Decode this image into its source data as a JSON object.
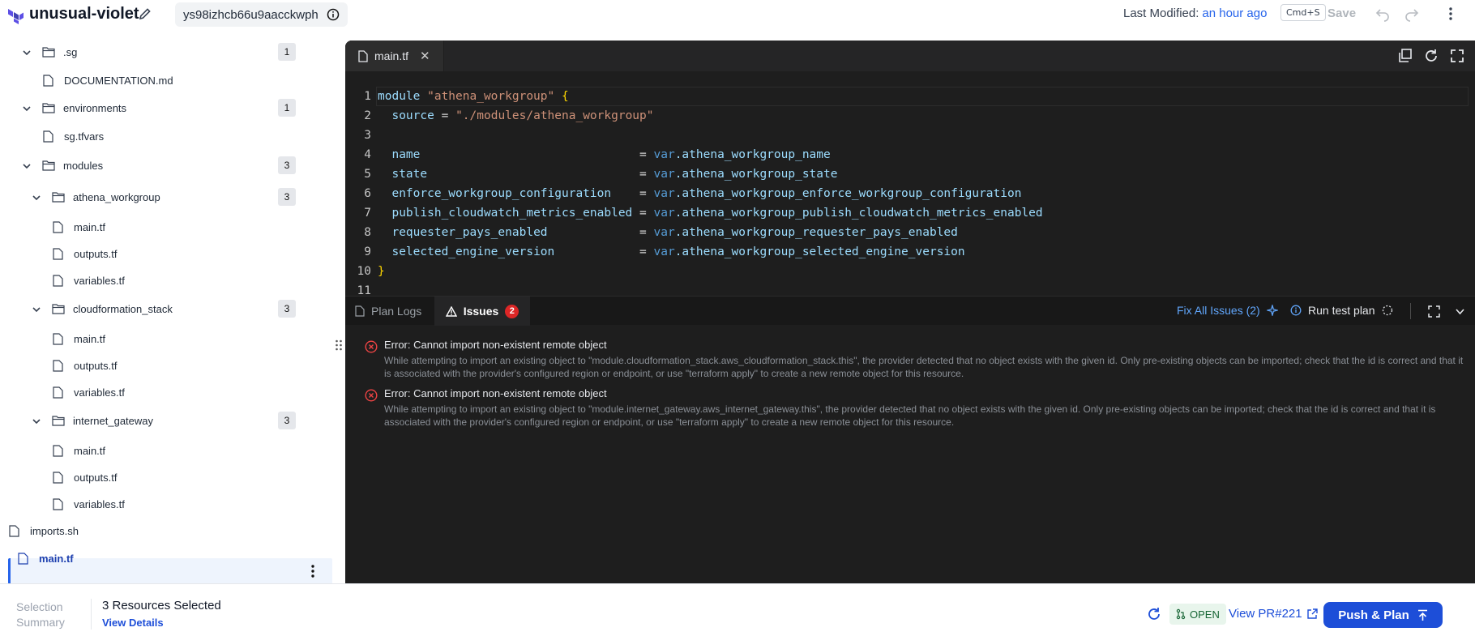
{
  "header": {
    "project_name": "unusual-violet",
    "commit_id": "ys98izhcb66u9aacckwph",
    "last_modified_label": "Last Modified:",
    "last_modified_value": "an hour ago",
    "shortcut": "Cmd+S",
    "save_label": "Save"
  },
  "sidebar": {
    "items": [
      {
        "label": ".sg",
        "count": "1"
      },
      {
        "label": "DOCUMENTATION.md"
      },
      {
        "label": "environments",
        "count": "1"
      },
      {
        "label": "sg.tfvars"
      },
      {
        "label": "modules",
        "count": "3"
      },
      {
        "label": "athena_workgroup",
        "count": "3"
      },
      {
        "label": "main.tf"
      },
      {
        "label": "outputs.tf"
      },
      {
        "label": "variables.tf"
      },
      {
        "label": "cloudformation_stack",
        "count": "3"
      },
      {
        "label": "main.tf"
      },
      {
        "label": "outputs.tf"
      },
      {
        "label": "variables.tf"
      },
      {
        "label": "internet_gateway",
        "count": "3"
      },
      {
        "label": "main.tf"
      },
      {
        "label": "outputs.tf"
      },
      {
        "label": "variables.tf"
      },
      {
        "label": "imports.sh"
      },
      {
        "label": "main.tf"
      }
    ]
  },
  "editor": {
    "tab_label": "main.tf",
    "lines": [
      {
        "n": "1",
        "kw": "module",
        "str": "\"athena_workgroup\"",
        "br": "{"
      },
      {
        "n": "2",
        "attr": "source",
        "pad": " = ",
        "str": "\"./modules/athena_workgroup\""
      },
      {
        "n": "3"
      },
      {
        "n": "4",
        "attr": "name",
        "pad": "                               = ",
        "var": "var",
        "ref": ".athena_workgroup_name"
      },
      {
        "n": "5",
        "attr": "state",
        "pad": "                              = ",
        "var": "var",
        "ref": ".athena_workgroup_state"
      },
      {
        "n": "6",
        "attr": "enforce_workgroup_configuration",
        "pad": "    = ",
        "var": "var",
        "ref": ".athena_workgroup_enforce_workgroup_configuration"
      },
      {
        "n": "7",
        "attr": "publish_cloudwatch_metrics_enabled",
        "pad": " = ",
        "var": "var",
        "ref": ".athena_workgroup_publish_cloudwatch_metrics_enabled"
      },
      {
        "n": "8",
        "attr": "requester_pays_enabled",
        "pad": "             = ",
        "var": "var",
        "ref": ".athena_workgroup_requester_pays_enabled"
      },
      {
        "n": "9",
        "attr": "selected_engine_version",
        "pad": "            = ",
        "var": "var",
        "ref": ".athena_workgroup_selected_engine_version"
      },
      {
        "n": "10",
        "br": "}"
      },
      {
        "n": "11"
      }
    ]
  },
  "panel": {
    "tab_logs": "Plan Logs",
    "tab_issues": "Issues",
    "issues_count": "2",
    "fix_all": "Fix All Issues (2)",
    "run_test": "Run test plan",
    "issues": [
      {
        "title": "Error: Cannot import non-existent remote object",
        "desc": "While attempting to import an existing object to \"module.cloudformation_stack.aws_cloudformation_stack.this\", the provider detected that no object exists with the given id. Only pre-existing objects can be imported; check that the id is correct and that it is associated with the provider's configured region or endpoint, or use \"terraform apply\" to create a new remote object for this resource."
      },
      {
        "title": "Error: Cannot import non-existent remote object",
        "desc": "While attempting to import an existing object to \"module.internet_gateway.aws_internet_gateway.this\", the provider detected that no object exists with the given id. Only pre-existing objects can be imported; check that the id is correct and that it is associated with the provider's configured region or endpoint, or use \"terraform apply\" to create a new remote object for this resource."
      }
    ]
  },
  "footer": {
    "selection_line1": "Selection",
    "selection_line2": "Summary",
    "resources_selected": "3 Resources Selected",
    "view_details": "View Details",
    "pr_status": "OPEN",
    "view_pr": "View PR#221",
    "push_plan": "Push & Plan"
  },
  "colors": {
    "accent": "#1d4ed8",
    "editor_bg": "#1e1e1e",
    "error": "#dc2626"
  }
}
